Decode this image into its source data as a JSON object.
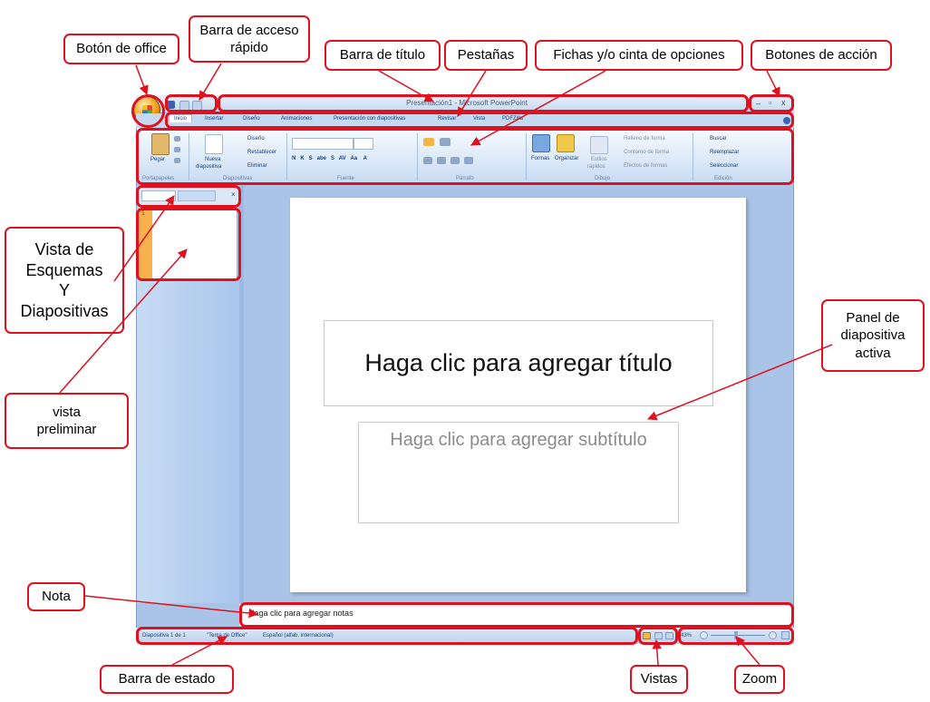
{
  "window": {
    "title": "Presentación1 - Microsoft PowerPoint",
    "tabs": [
      "Inicio",
      "Insertar",
      "Diseño",
      "Animaciones",
      "Presentación con diapositivas",
      "Revisar",
      "Vista",
      "PDFZilla"
    ],
    "controls": {
      "minimize": "–",
      "maximize": "▫",
      "close": "x"
    }
  },
  "ribbon": {
    "paste": "Pegar",
    "clipboard": "Portapapeles",
    "new_slide_line1": "Nueva",
    "new_slide_line2": "diapositiva",
    "layout": "Diseño",
    "reset": "Restablecer",
    "delete": "Eliminar",
    "slides_group": "Diapositivas",
    "font_group": "Fuente",
    "paragraph_group": "Párrafo",
    "shapes": "Formas",
    "arrange": "Organizar",
    "quick_styles_line1": "Estilos",
    "quick_styles_line2": "rápidos",
    "shape_fill": "Relleno de forma",
    "shape_outline": "Contorno de forma",
    "shape_effects": "Efectos de formas",
    "drawing_group": "Dibujo",
    "find": "Buscar",
    "replace": "Reemplazar",
    "select": "Seleccionar",
    "editing_group": "Edición"
  },
  "slide": {
    "title_placeholder": "Haga clic para agregar título",
    "subtitle_placeholder": "Haga clic para agregar subtítulo",
    "thumbnail_number": "1"
  },
  "notes": {
    "placeholder": "Haga clic para agregar notas"
  },
  "statusbar": {
    "slide_count": "Diapositiva 1 de 1",
    "theme": "\"Tema de Office\"",
    "language": "Español (alfab. internacional)",
    "zoom": "43%"
  },
  "annotations": {
    "office_button": "Botón de office",
    "quick_access_line1": "Barra de acceso",
    "quick_access_line2": "rápido",
    "title_bar": "Barra de título",
    "tabs": "Pestañas",
    "ribbon": "Fichas y/o cinta de opciones",
    "action_buttons": "Botones de acción",
    "outline_view_line1": "Vista de",
    "outline_view_line2": "Esquemas",
    "outline_view_line3": "Y",
    "outline_view_line4": "Diapositivas",
    "preview_line1": "vista",
    "preview_line2": "preliminar",
    "active_slide_line1": "Panel de",
    "active_slide_line2": "diapositiva",
    "active_slide_line3": "activa",
    "note": "Nota",
    "status_bar": "Barra de estado",
    "views": "Vistas",
    "zoom": "Zoom"
  },
  "colors": {
    "annotation_red": "#e0101f",
    "window_blue": "#a9c4e6",
    "ribbon_text": "#15428b"
  }
}
